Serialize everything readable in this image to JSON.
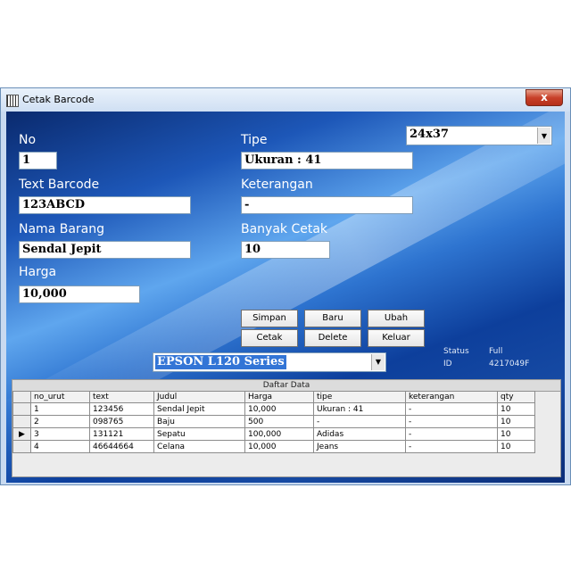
{
  "window": {
    "title": "Cetak Barcode",
    "close_glyph": "x"
  },
  "form": {
    "no_label": "No",
    "no_value": "1",
    "text_barcode_label": "Text Barcode",
    "text_barcode_value": "123ABCD",
    "nama_barang_label": "Nama Barang",
    "nama_barang_value": "Sendal Jepit",
    "harga_label": "Harga",
    "harga_value": "10,000",
    "tipe_label": "Tipe",
    "tipe_value": "Ukuran : 41",
    "size_select_value": "24x37",
    "keterangan_label": "Keterangan",
    "keterangan_value": "-",
    "banyak_cetak_label": "Banyak Cetak",
    "banyak_cetak_value": "10"
  },
  "buttons": {
    "simpan": "Simpan",
    "baru": "Baru",
    "ubah": "Ubah",
    "cetak": "Cetak",
    "delete": "Delete",
    "keluar": "Keluar"
  },
  "printer": {
    "selected": "EPSON L120 Series"
  },
  "status": {
    "status_label": "Status",
    "status_value": "Full",
    "id_label": "ID",
    "id_value": "4217049F"
  },
  "grid": {
    "caption": "Daftar Data",
    "columns": [
      "no_urut",
      "text",
      "Judul",
      "Harga",
      "tipe",
      "keterangan",
      "qty"
    ],
    "rows": [
      {
        "no_urut": "1",
        "text": "123456",
        "judul": "Sendal Jepit",
        "harga": "10,000",
        "tipe": "Ukuran : 41",
        "keterangan": "-",
        "qty": "10"
      },
      {
        "no_urut": "2",
        "text": "098765",
        "judul": "Baju",
        "harga": "500",
        "tipe": "-",
        "keterangan": "-",
        "qty": "10"
      },
      {
        "no_urut": "3",
        "text": "131121",
        "judul": "Sepatu",
        "harga": "100,000",
        "tipe": "Adidas",
        "keterangan": "-",
        "qty": "10"
      },
      {
        "no_urut": "4",
        "text": "46644664",
        "judul": "Celana",
        "harga": "10,000",
        "tipe": "Jeans",
        "keterangan": "-",
        "qty": "10"
      }
    ],
    "current_row_marker": "▶"
  },
  "icons": {
    "app_icon": "barcode-icon",
    "dropdown_icon": "chevron-down-icon"
  },
  "colors": {
    "window_background": "#1d57b8",
    "titlebar": "#cfdff3",
    "close_button": "#c8412a",
    "selection": "#3375d6"
  }
}
